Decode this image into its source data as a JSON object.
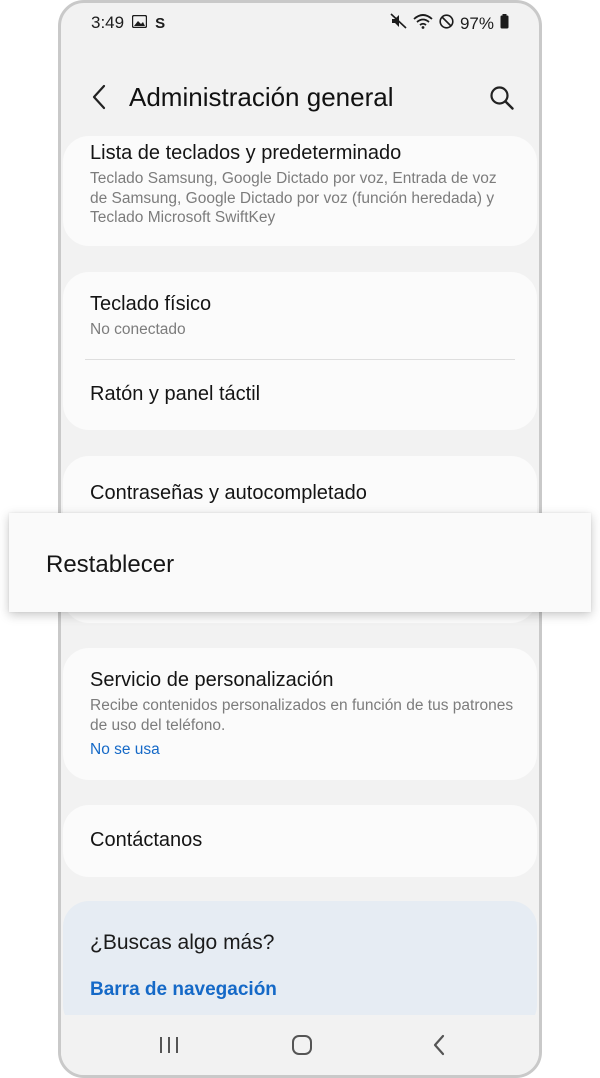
{
  "status_bar": {
    "time": "3:49",
    "battery": "97%"
  },
  "header": {
    "title": "Administración general"
  },
  "items": {
    "keyboards": {
      "title": "Lista de teclados y predeterminado",
      "subtitle": "Teclado Samsung, Google Dictado por voz, Entrada de voz de Samsung, Google Dictado por voz (función heredada) y Teclado Microsoft SwiftKey"
    },
    "physical_keyboard": {
      "title": "Teclado físico",
      "subtitle": "No conectado"
    },
    "mouse": {
      "title": "Ratón y panel táctil"
    },
    "passwords": {
      "title": "Contraseñas y autocompletado"
    },
    "personalization": {
      "title": "Servicio de personalización",
      "subtitle": "Recibe contenidos personalizados en función de tus patrones de uso del teléfono.",
      "status": "No se usa"
    },
    "contact": {
      "title": "Contáctanos"
    }
  },
  "suggestions": {
    "title": "¿Buscas algo más?",
    "link": "Barra de navegación"
  },
  "highlight": {
    "label": "Restablecer"
  },
  "colors": {
    "link": "#1569c7",
    "background": "#f2f2f2",
    "card": "#fbfbfb",
    "suggestion_card": "#e6ecf3"
  },
  "icons": {
    "back": "chevron-left",
    "search": "magnifier",
    "nav_recents": "three-bars",
    "nav_home": "rounded-square",
    "nav_back": "chevron-left"
  }
}
